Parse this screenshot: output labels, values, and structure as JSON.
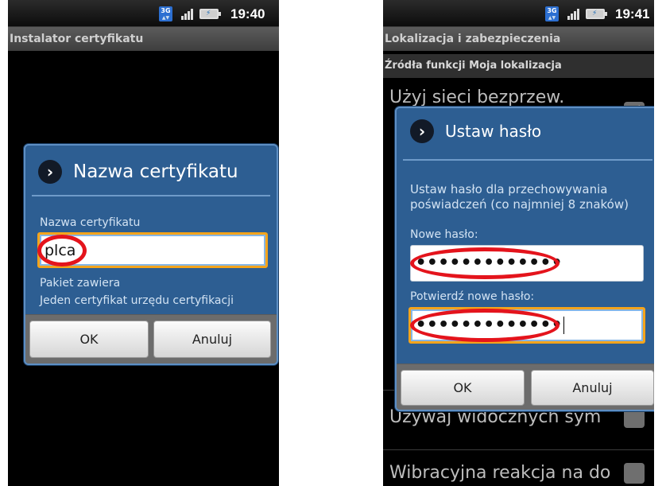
{
  "left_screen": {
    "status": {
      "net": "3G",
      "clock": "19:40"
    },
    "app_title": "Instalator certyfikatu",
    "dialog": {
      "title": "Nazwa certyfikatu",
      "field_label": "Nazwa certyfikatu",
      "field_value": "plca",
      "info_line1": "Pakiet zawiera",
      "info_line2": "Jeden certyfikat urzędu certyfikacji",
      "ok": "OK",
      "cancel": "Anuluj"
    }
  },
  "right_screen": {
    "status": {
      "net": "3G",
      "clock": "19:41"
    },
    "app_title": "Lokalizacja i zabezpieczenia",
    "section_header": "Źródła funkcji Moja lokalizacja",
    "background_items": [
      "Użyj sieci bezprzew.",
      "Używaj widocznych sym",
      "Wibracyjna reakcja na do"
    ],
    "dialog": {
      "title": "Ustaw hasło",
      "description": "Ustaw hasło dla przechowywania poświadczeń (co najmniej 8 znaków)",
      "new_label": "Nowe hasło:",
      "new_value": "•••••••••••••",
      "confirm_label": "Potwierdź nowe hasło:",
      "confirm_value": "•••••••••••••",
      "ok": "OK",
      "cancel": "Anuluj"
    }
  },
  "icons": [
    "3g-icon",
    "signal-icon",
    "battery-charging-icon",
    "arrow-right-icon"
  ],
  "colors": {
    "dialog_bg": "#2d5e92",
    "highlight": "#e4141c",
    "focus": "#f4a41c"
  }
}
